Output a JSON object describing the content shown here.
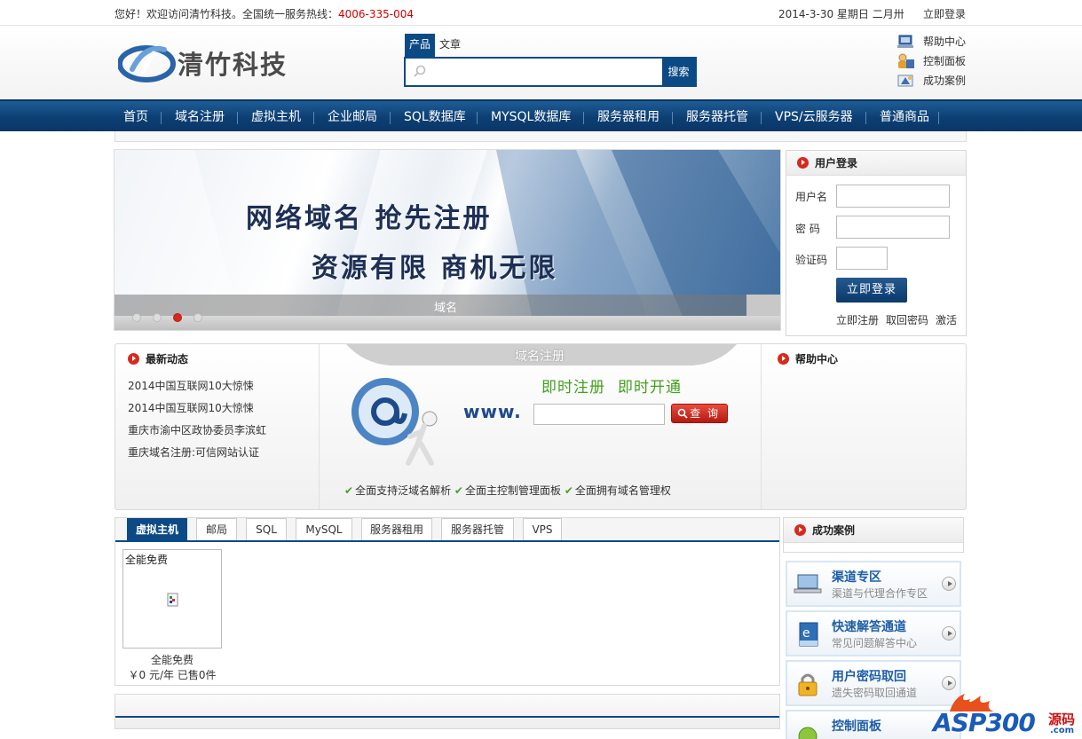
{
  "topbar": {
    "welcome": "您好！欢迎访问清竹科技。全国统一服务热线：",
    "hotline": "4006-335-004",
    "date": "2014-3-30 星期日 二月卅",
    "login": "立即登录"
  },
  "header": {
    "logo_text": "清竹科技",
    "search_tabs": [
      "产品",
      "文章"
    ],
    "search_placeholder": "",
    "search_button": "搜索",
    "quick_links": [
      {
        "label": "帮助中心",
        "icon": "help-center-icon"
      },
      {
        "label": "控制面板",
        "icon": "control-panel-icon"
      },
      {
        "label": "成功案例",
        "icon": "success-cases-icon"
      }
    ]
  },
  "nav": {
    "items": [
      "首页",
      "域名注册",
      "虚拟主机",
      "企业邮局",
      "SQL数据库",
      "MYSQL数据库",
      "服务器租用",
      "服务器托管",
      "VPS/云服务器",
      "普通商品"
    ]
  },
  "banner": {
    "line1": "网络域名  抢先注册",
    "line2": "资源有限  商机无限",
    "caption": "域名",
    "slide_count": 4,
    "active_slide": 3
  },
  "login_panel": {
    "title": "用户登录",
    "username_label": "用户名",
    "password_label": "密  码",
    "captcha_label": "验证码",
    "submit": "立即登录",
    "links": [
      "立即注册",
      "取回密码",
      "激活"
    ]
  },
  "news": {
    "title": "最新动态",
    "items": [
      "2014中国互联网10大惊悚",
      "2014中国互联网10大惊悚",
      "重庆市渝中区政协委员李滨虹",
      "重庆域名注册:可信网站认证"
    ]
  },
  "domain": {
    "tab_title": "域名注册",
    "slogan": [
      "即时注册",
      "即时开通"
    ],
    "www": "www.",
    "query_button": "查 询",
    "features": [
      "全面支持泛域名解析",
      "全面主控制管理面板",
      "全面拥有域名管理权"
    ]
  },
  "help": {
    "title": "帮助中心"
  },
  "products": {
    "tabs": [
      "虚拟主机",
      "邮局",
      "SQL",
      "MySQL",
      "服务器租用",
      "服务器托管",
      "VPS"
    ],
    "active_tab": 0,
    "card_title": "全能免费",
    "name": "全能免费",
    "price": "￥0 元/年 已售0件"
  },
  "success": {
    "title": "成功案例",
    "items": [
      {
        "title": "渠道专区",
        "sub": "渠道与代理合作专区",
        "icon": "laptop-icon"
      },
      {
        "title": "快速解答通道",
        "sub": "常见问题解答中心",
        "icon": "guide-icon"
      },
      {
        "title": "用户密码取回",
        "sub": "遗失密码取回通道",
        "icon": "padlock-icon"
      },
      {
        "title": "控制面板",
        "sub": "",
        "icon": "control-panel-icon"
      }
    ]
  },
  "watermark": {
    "text": "ASP300",
    "side": "源码",
    "domain": ".com"
  },
  "colors": {
    "nav_blue": "#0d3f73",
    "hotline_red": "#d40000",
    "slogan_green": "#43a11e",
    "case_title_blue": "#1d5ea8"
  }
}
